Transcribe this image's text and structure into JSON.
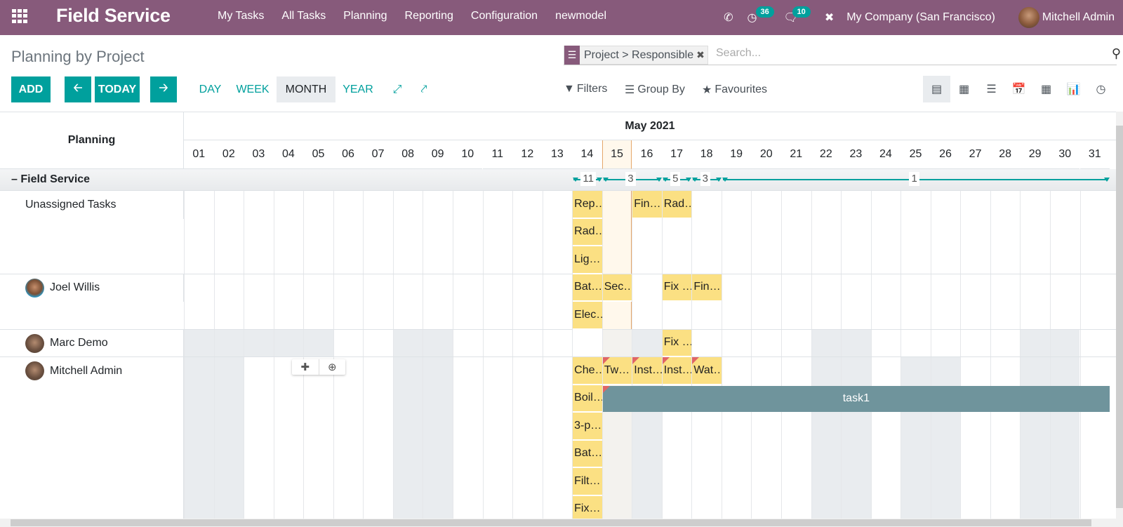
{
  "navbar": {
    "app_title": "Field Service",
    "menu": [
      "My Tasks",
      "All Tasks",
      "Planning",
      "Reporting",
      "Configuration",
      "newmodel"
    ],
    "activity_count": "36",
    "message_count": "10",
    "company": "My Company (San Francisco)",
    "user": "Mitchell Admin"
  },
  "control_panel": {
    "title": "Planning by Project",
    "add_label": "ADD",
    "today_label": "TODAY",
    "scales": [
      "DAY",
      "WEEK",
      "MONTH",
      "YEAR"
    ],
    "active_scale": "MONTH",
    "search": {
      "facet": "Project > Responsible",
      "placeholder": "Search..."
    },
    "filters_label": "Filters",
    "groupby_label": "Group By",
    "favourites_label": "Favourites",
    "views": [
      "gantt",
      "kanban",
      "list",
      "calendar",
      "pivot",
      "graph",
      "activity"
    ],
    "active_view": "gantt"
  },
  "gantt": {
    "left_header": "Planning",
    "month": "May 2021",
    "days": [
      "01",
      "02",
      "03",
      "04",
      "05",
      "06",
      "07",
      "08",
      "09",
      "10",
      "11",
      "12",
      "13",
      "14",
      "15",
      "16",
      "17",
      "18",
      "19",
      "20",
      "21",
      "22",
      "23",
      "24",
      "25",
      "26",
      "27",
      "28",
      "29",
      "30",
      "31"
    ],
    "today": "15",
    "group": {
      "label": "Field Service",
      "counts": [
        {
          "from": 14,
          "to": 14,
          "value": "11"
        },
        {
          "from": 15,
          "to": 16,
          "value": "3"
        },
        {
          "from": 17,
          "to": 17,
          "value": "5"
        },
        {
          "from": 18,
          "to": 18,
          "value": "3"
        },
        {
          "from": 19,
          "to": 31,
          "value": "1"
        }
      ]
    },
    "rows": [
      {
        "name": "Unassigned Tasks",
        "avatar": false,
        "lines": 3,
        "unavailable": [],
        "tasks": [
          {
            "label": "Rep…",
            "day": 14,
            "line": 0
          },
          {
            "label": "Fin…",
            "day": 16,
            "line": 0
          },
          {
            "label": "Rad…",
            "day": 17,
            "line": 0
          },
          {
            "label": "Rad…",
            "day": 14,
            "line": 1
          },
          {
            "label": "Lig…",
            "day": 14,
            "line": 2
          }
        ]
      },
      {
        "name": "Joel Willis",
        "avatar": true,
        "lines": 2,
        "unavailable": [],
        "tasks": [
          {
            "label": "Bat…",
            "day": 14,
            "line": 0
          },
          {
            "label": "Sec…",
            "day": 15,
            "line": 0
          },
          {
            "label": "Fix …",
            "day": 17,
            "line": 0
          },
          {
            "label": "Fin…",
            "day": 18,
            "line": 0
          },
          {
            "label": "Elec…",
            "day": 14,
            "line": 1
          }
        ]
      },
      {
        "name": "Marc Demo",
        "avatar": true,
        "lines": 1,
        "unavailable": [
          1,
          2,
          3,
          4,
          5,
          8,
          9,
          15,
          16,
          22,
          23,
          29,
          30
        ],
        "tasks": [
          {
            "label": "Fix …",
            "day": 17,
            "line": 0
          }
        ]
      },
      {
        "name": "Mitchell Admin",
        "avatar": true,
        "lines": 6,
        "unavailable": [
          1,
          2,
          8,
          9,
          15,
          16,
          22,
          23,
          25,
          26,
          29,
          30
        ],
        "tasks": [
          {
            "label": "Che…",
            "day": 14,
            "line": 0
          },
          {
            "label": "Tw…",
            "day": 15,
            "line": 0,
            "flag": true
          },
          {
            "label": "Inst…",
            "day": 16,
            "line": 0,
            "flag": true
          },
          {
            "label": "Inst…",
            "day": 17,
            "line": 0,
            "flag": true
          },
          {
            "label": "Wat…",
            "day": 18,
            "line": 0,
            "flag": true
          },
          {
            "label": "Boil…",
            "day": 14,
            "line": 1
          },
          {
            "label": "3-p…",
            "day": 14,
            "line": 2
          },
          {
            "label": "Bat…",
            "day": 14,
            "line": 3
          },
          {
            "label": "Filt…",
            "day": 14,
            "line": 4
          },
          {
            "label": "Fix…",
            "day": 14,
            "line": 5
          }
        ],
        "long_task": {
          "label": "task1",
          "from": 15,
          "to": 31,
          "line": 1,
          "flag": true
        }
      }
    ]
  },
  "colors": {
    "brand": "#875a7b",
    "accent": "#00a09d",
    "task": "#fbe083",
    "long_task": "#6f949c",
    "overdue": "#e06565"
  }
}
